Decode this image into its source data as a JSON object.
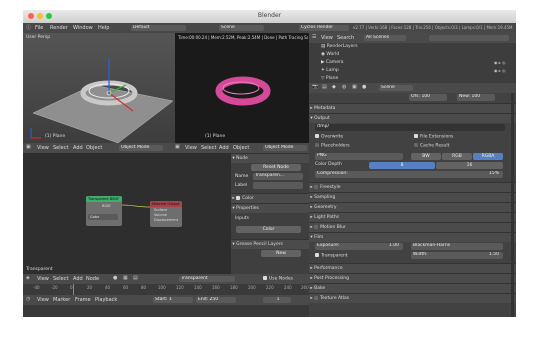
{
  "window": {
    "title": "Blender"
  },
  "info_header": {
    "menus": [
      "File",
      "Render",
      "Window",
      "Help"
    ],
    "screen_layout": "Default",
    "scene": "Scene",
    "engine": "Cycles Render",
    "stats": "v2.77 | Verts:168 | Faces:128 | Tris:256 | Objects:0/3 | Lamps:0/1 | Mem:19.45M",
    "render_info": "Time:00:00.24 | Mem:2.52M, Peak:2.54M | Done | Path Tracing Sample 10/10"
  },
  "viewport_left": {
    "label": "User Persp",
    "object": "(1) Plane"
  },
  "viewport_right": {
    "object": "(1) Plane"
  },
  "view3d_header": {
    "menus": [
      "View",
      "Select",
      "Add",
      "Object"
    ],
    "mode": "Object Mode"
  },
  "view3d_header_right": {
    "menus": [
      "View",
      "Select",
      "Add",
      "Object"
    ],
    "mode": "Object Mode"
  },
  "node_editor": {
    "node_title": "Transparent BSDF",
    "node_output": "BSDF",
    "node_color": "Color",
    "output_title": "Material Output",
    "output_sockets": [
      "Surface",
      "Volume",
      "Displacement"
    ],
    "material_label": "Transparent"
  },
  "node_panel": {
    "node_header": "Node",
    "reset_node": "Reset Node",
    "name_label": "Name",
    "name_value": "Transparen...",
    "label_label": "Label",
    "color_label": "Color",
    "properties_label": "Properties",
    "inputs_label": "Inputs",
    "inputs_color": "Color",
    "grease_pencil": "Grease Pencil Layers",
    "new_button": "New"
  },
  "node_header": {
    "menus": [
      "View",
      "Select",
      "Add",
      "Node"
    ],
    "material": "Transparent",
    "use_nodes": "Use Nodes"
  },
  "timeline": {
    "ticks": [
      "-40",
      "-20",
      "0",
      "20",
      "40",
      "60",
      "80",
      "100",
      "120",
      "140",
      "160",
      "180",
      "200",
      "220",
      "240",
      "260"
    ],
    "menus": [
      "View",
      "Marker",
      "Frame",
      "Playback"
    ],
    "start_label": "Start:",
    "start_value": "1",
    "end_label": "End:",
    "end_value": "250",
    "current": "1"
  },
  "outliner": {
    "header": {
      "view": "View",
      "search": "Search",
      "scenes": "All Scenes"
    },
    "items": [
      "RenderLayers",
      "World",
      "Camera",
      "Lamp",
      "Plane"
    ]
  },
  "properties": {
    "scene_label": "Scene",
    "ofs_label": "Ofs:",
    "ofs_value": "100",
    "new_label": "New:",
    "new_value": "100",
    "metadata": "Metadata",
    "output": "Output",
    "output_path": "/tmp/",
    "overwrite": "Overwrite",
    "file_extensions": "File Extensions",
    "placeholders": "Placeholders",
    "cache_result": "Cache Result",
    "format": "PNG",
    "bw": "BW",
    "rgb": "RGB",
    "rgba": "RGBA",
    "color_depth": "Color Depth",
    "depth_8": "8",
    "depth_16": "16",
    "compression_label": "Compression:",
    "compression_value": "15%",
    "freestyle": "Freestyle",
    "sampling": "Sampling",
    "geometry": "Geometry",
    "light_paths": "Light Paths",
    "motion_blur": "Motion Blur",
    "film": "Film",
    "exposure_label": "Exposure:",
    "exposure_value": "1.00",
    "filter": "Blackman-Harris",
    "transparent": "Transparent",
    "width_label": "Width:",
    "width_value": "1.50",
    "performance": "Performance",
    "post_processing": "Post Processing",
    "bake": "Bake",
    "texture_atlas": "Texture Atlas"
  },
  "colors": {
    "accent_blue": "#5680c2",
    "torus_magenta": "#d54a98",
    "node_bg": "#2e2e2e"
  }
}
